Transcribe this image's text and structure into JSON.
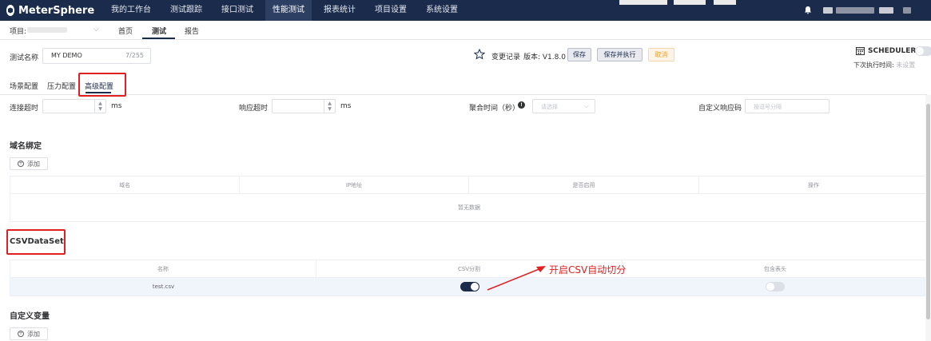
{
  "topnav": {
    "logo": "MeterSphere",
    "menu": [
      {
        "label": "我的工作台",
        "active": false
      },
      {
        "label": "测试跟踪",
        "active": false
      },
      {
        "label": "接口测试",
        "active": false
      },
      {
        "label": "性能测试",
        "active": true
      },
      {
        "label": "报表统计",
        "active": false
      },
      {
        "label": "项目设置",
        "active": false
      },
      {
        "label": "系统设置",
        "active": false
      }
    ]
  },
  "subnav": {
    "project_label": "项目:",
    "items": [
      {
        "label": "首页",
        "active": false
      },
      {
        "label": "测试",
        "active": true
      },
      {
        "label": "报告",
        "active": false
      }
    ]
  },
  "test": {
    "name_label": "测试名称",
    "name_value": "MY DEMO",
    "name_count": "7/255",
    "change_log": "变更记录",
    "version_label": "版本: V1.8.0",
    "save": "保存",
    "save_run": "保存并执行",
    "cancel": "取消",
    "scheduler": "SCHEDULER",
    "next_run_label": "下次执行时间:",
    "next_run_value": "未设置"
  },
  "config_tabs": [
    {
      "label": "场景配置",
      "active": false
    },
    {
      "label": "压力配置",
      "active": false
    },
    {
      "label": "高级配置",
      "active": true
    }
  ],
  "form": {
    "connect_timeout": "连接超时",
    "response_timeout": "响应超时",
    "unit_ms": "ms",
    "aggregate_time": "聚合时间（秒）",
    "aggregate_placeholder": "请选择",
    "custom_code": "自定义响应码",
    "custom_code_placeholder": "按逗号分隔"
  },
  "domain_binding": {
    "title": "域名绑定",
    "add": "添加",
    "columns": [
      "域名",
      "IP地址",
      "是否启用",
      "操作"
    ],
    "empty": "暂无数据"
  },
  "csv": {
    "title": "CSVDataSet",
    "columns": [
      "名称",
      "CSV分割",
      "包含表头"
    ],
    "rows": [
      {
        "name": "test.csv",
        "split": true,
        "header": false
      }
    ]
  },
  "annotation": "开启CSV自动切分",
  "custom_vars": {
    "title": "自定义变量",
    "add": "添加"
  },
  "colors": {
    "nav_bg": "#1a2b4c",
    "accent": "#1a2b4c",
    "annotation": "#e02020",
    "cancel": "#e6a23c"
  }
}
